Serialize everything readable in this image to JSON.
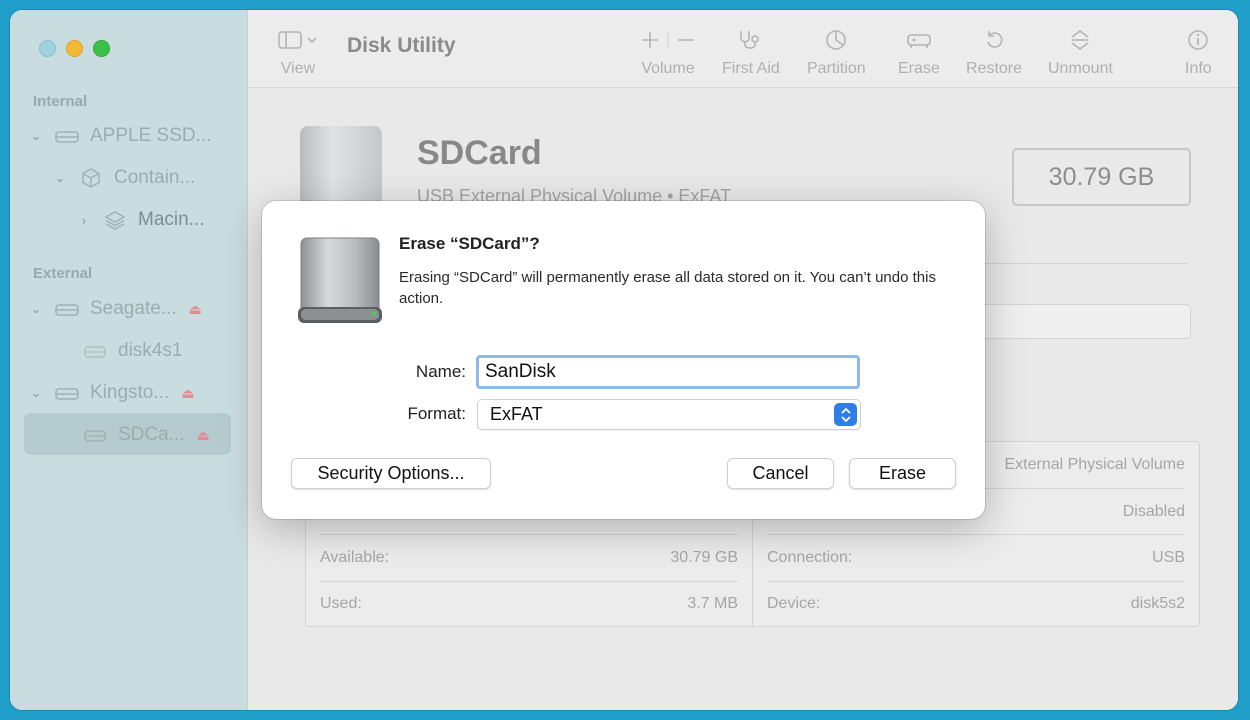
{
  "colors": {
    "desktop": "#1f9fc9",
    "sidebar": "#c9dcdf",
    "accent": "#2f7ee8",
    "focus_ring": "#8fb8ec",
    "traffic_close": "#9ed3dd",
    "traffic_min": "#f6b937",
    "traffic_max": "#3bc14a",
    "eject": "#e58c93"
  },
  "sidebar": {
    "sections": [
      {
        "label": "Internal"
      },
      {
        "label": "External"
      }
    ],
    "items": [
      {
        "label": "APPLE SSD...",
        "icon": "internal-disk-icon",
        "chevron": "expanded"
      },
      {
        "label": "Contain...",
        "icon": "container-icon",
        "chevron": "expanded"
      },
      {
        "label": "Macin...",
        "icon": "layers-icon",
        "chevron": "collapsed"
      },
      {
        "label": "Seagate...",
        "icon": "external-disk-icon",
        "chevron": "expanded",
        "eject": true
      },
      {
        "label": "disk4s1",
        "icon": "volume-icon"
      },
      {
        "label": "Kingsto...",
        "icon": "external-disk-icon",
        "chevron": "expanded",
        "eject": true
      },
      {
        "label": "SDCa...",
        "icon": "volume-icon",
        "selected": true,
        "eject": true
      }
    ]
  },
  "toolbar": {
    "title": "Disk Utility",
    "view_label": "View",
    "volume_label": "Volume",
    "first_aid_label": "First Aid",
    "partition_label": "Partition",
    "erase_label": "Erase",
    "restore_label": "Restore",
    "unmount_label": "Unmount",
    "info_label": "Info"
  },
  "volume": {
    "name": "SDCard",
    "description": "USB External Physical Volume • ExFAT",
    "size": "30.79 GB"
  },
  "info": {
    "right_rows": [
      {
        "label": "",
        "value": "External Physical Volume"
      },
      {
        "label": "",
        "value": "Disabled"
      },
      {
        "label": "Connection:",
        "value": "USB"
      },
      {
        "label": "Device:",
        "value": "disk5s2"
      }
    ],
    "left_rows": [
      {
        "label": "Available:",
        "value": "30.79 GB"
      },
      {
        "label": "Used:",
        "value": "3.7 MB"
      }
    ]
  },
  "dialog": {
    "title": "Erase “SDCard”?",
    "message": "Erasing “SDCard” will permanently erase all data stored on it. You can’t undo this action.",
    "name_label": "Name:",
    "name_value": "SanDisk",
    "format_label": "Format:",
    "format_value": "ExFAT",
    "security_options_label": "Security Options...",
    "cancel_label": "Cancel",
    "erase_label": "Erase"
  }
}
